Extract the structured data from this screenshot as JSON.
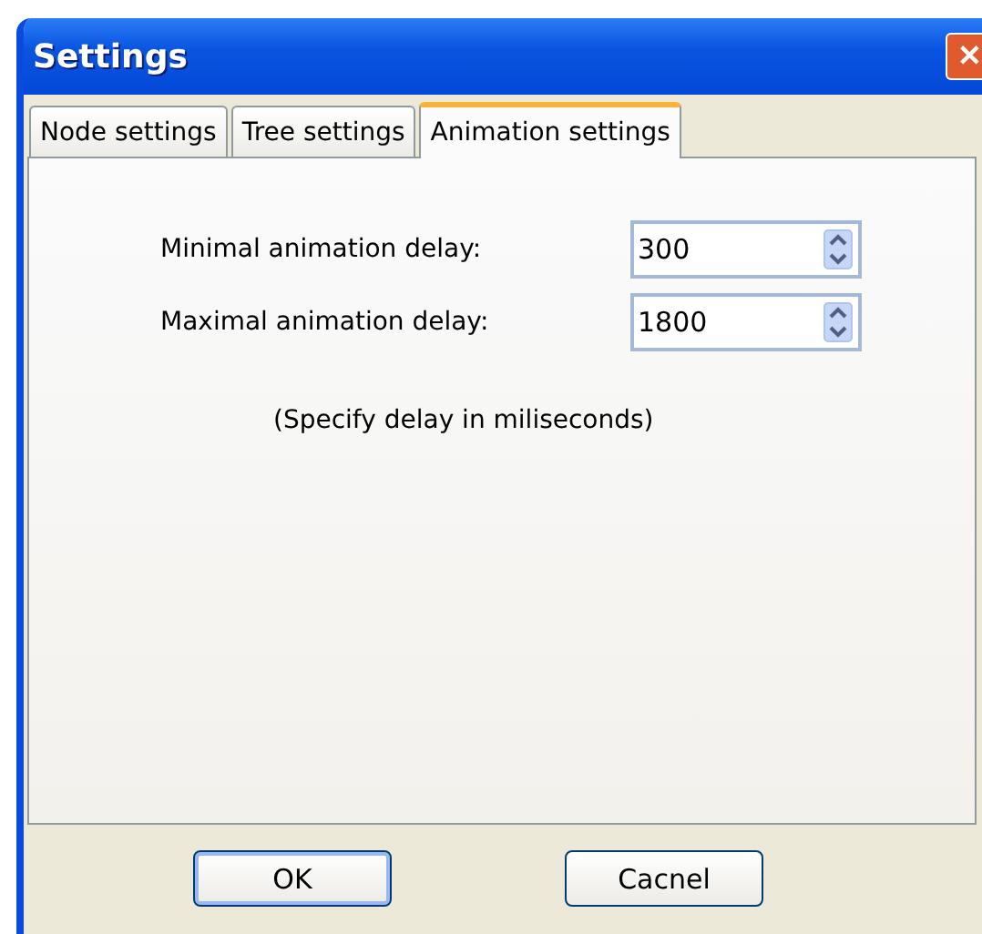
{
  "window": {
    "title": "Settings",
    "close": "✕"
  },
  "tabs": [
    {
      "label": "Node settings",
      "selected": false
    },
    {
      "label": "Tree settings",
      "selected": false
    },
    {
      "label": "Animation settings",
      "selected": true
    }
  ],
  "fields": [
    {
      "label": "Minimal animation delay:",
      "value": "300"
    },
    {
      "label": "Maximal animation delay:",
      "value": "1800"
    }
  ],
  "hint": "(Specify delay in miliseconds)",
  "buttons": [
    {
      "label": "OK",
      "default": true
    },
    {
      "label": "Cacnel",
      "default": false
    }
  ]
}
